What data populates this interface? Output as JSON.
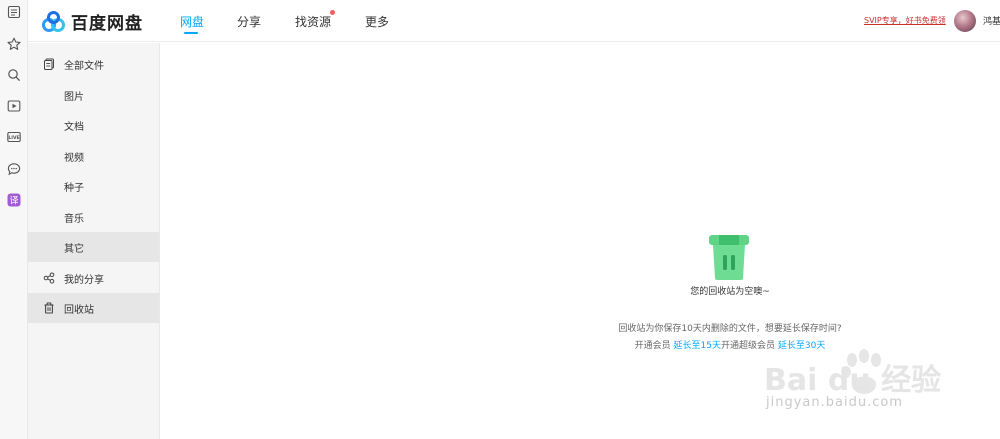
{
  "colors": {
    "accent": "#06a7ff",
    "svip": "#c9302c",
    "trash": "#5fd386",
    "trash_dark": "#2fb768"
  },
  "rail": {
    "icons": [
      "list-icon",
      "star-icon",
      "search-icon",
      "video-icon",
      "live-icon",
      "chat-icon",
      "translate-icon"
    ],
    "live_label": "LIVE",
    "translate_glyph": "译"
  },
  "header": {
    "logo_text": "百度网盘",
    "tabs": [
      {
        "label": "网盘",
        "active": true
      },
      {
        "label": "分享",
        "active": false
      },
      {
        "label": "找资源",
        "active": false,
        "badge": true
      },
      {
        "label": "更多",
        "active": false
      }
    ],
    "svip_link": "SVIP专享，好书免费领",
    "username": "鸿基"
  },
  "sidebar": {
    "items": [
      {
        "label": "全部文件",
        "icon": "files-icon",
        "selected": false
      },
      {
        "label": "图片",
        "selected": false
      },
      {
        "label": "文档",
        "selected": false
      },
      {
        "label": "视频",
        "selected": false
      },
      {
        "label": "种子",
        "selected": false
      },
      {
        "label": "音乐",
        "selected": false
      },
      {
        "label": "其它",
        "selected": true
      },
      {
        "label": "我的分享",
        "icon": "share-icon",
        "selected": false
      },
      {
        "label": "回收站",
        "icon": "trash-icon",
        "selected": true
      }
    ]
  },
  "main": {
    "empty_title": "您的回收站为空噢~",
    "hint_line1": "回收站为你保存10天内删除的文件，想要延长保存时间?",
    "hint_prefix": "开通会员",
    "hint_link1": "延长至15天",
    "hint_middle": "开通超级会员",
    "hint_link2": "延长至30天"
  },
  "watermark": {
    "brand": "Bai du 经验",
    "url": "jingyan.baidu.com"
  }
}
